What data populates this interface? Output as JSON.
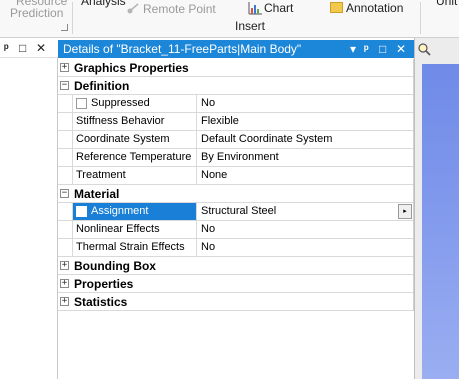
{
  "ribbon": {
    "resource_prediction_line1": "Resource",
    "resource_prediction_line2": "Prediction",
    "analysis_label": "Analysis",
    "remote_point_label": "Remote Point",
    "chart_label": "Chart",
    "annotation_label": "Annotation",
    "insert_group_label": "Insert",
    "units_label": "Unit"
  },
  "left_pane": {
    "pin_glyph": "ᵖ",
    "maximize_glyph": "□",
    "close_glyph": "✕"
  },
  "details": {
    "title": "Details of \"Bracket_11-FreeParts|Main Body\"",
    "dropdown_glyph": "▾",
    "pin_glyph": "ᵖ",
    "maximize_glyph": "□",
    "close_glyph": "✕",
    "sections": {
      "graphics_properties": {
        "label": "Graphics Properties",
        "expander": "+"
      },
      "definition": {
        "label": "Definition",
        "expander": "−"
      },
      "material": {
        "label": "Material",
        "expander": "−"
      },
      "bounding_box": {
        "label": "Bounding Box",
        "expander": "+"
      },
      "properties": {
        "label": "Properties",
        "expander": "+"
      },
      "statistics": {
        "label": "Statistics",
        "expander": "+"
      }
    },
    "definition_rows": {
      "suppressed": {
        "name": "Suppressed",
        "value": "No"
      },
      "stiffness": {
        "name": "Stiffness Behavior",
        "value": "Flexible"
      },
      "coord": {
        "name": "Coordinate System",
        "value": "Default Coordinate System"
      },
      "reftemp": {
        "name": "Reference Temperature",
        "value": "By Environment"
      },
      "treatment": {
        "name": "Treatment",
        "value": "None"
      }
    },
    "material_rows": {
      "assignment": {
        "name": "Assignment",
        "value": "Structural Steel",
        "selected": true
      },
      "nonlinear": {
        "name": "Nonlinear Effects",
        "value": "No"
      },
      "thermal": {
        "name": "Thermal Strain Effects",
        "value": "No"
      }
    },
    "dropdown_arrow": "▸"
  },
  "colors": {
    "title_bar": "#1c86d9",
    "selection": "#1a7fd6",
    "viewport": "#7f97ec"
  }
}
